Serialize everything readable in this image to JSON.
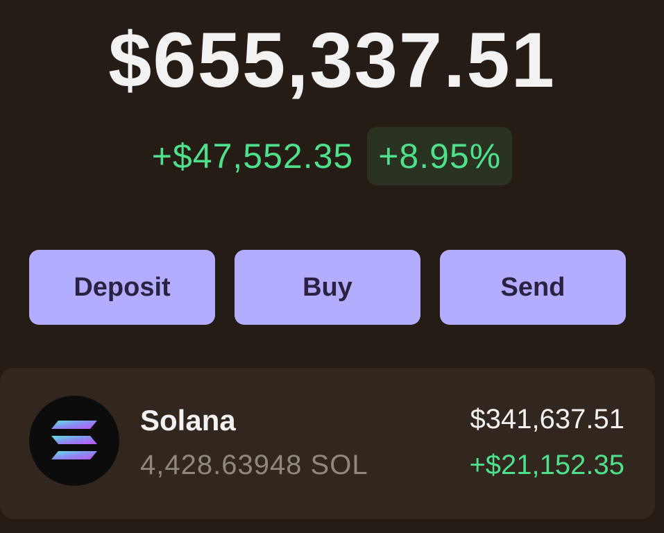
{
  "portfolio": {
    "balance": "$655,337.51",
    "change_amount": "+$47,552.35",
    "change_percent": "+8.95%"
  },
  "actions": {
    "deposit_label": "Deposit",
    "buy_label": "Buy",
    "send_label": "Send"
  },
  "tokens": [
    {
      "name": "Solana",
      "amount": "4,428.63948 SOL",
      "value": "$341,637.51",
      "change": "+$21,152.35",
      "icon": "solana-logo-icon"
    }
  ],
  "colors": {
    "background": "#251d15",
    "positive": "#4ee08a",
    "button": "#b3adff",
    "card": "#32271e"
  }
}
